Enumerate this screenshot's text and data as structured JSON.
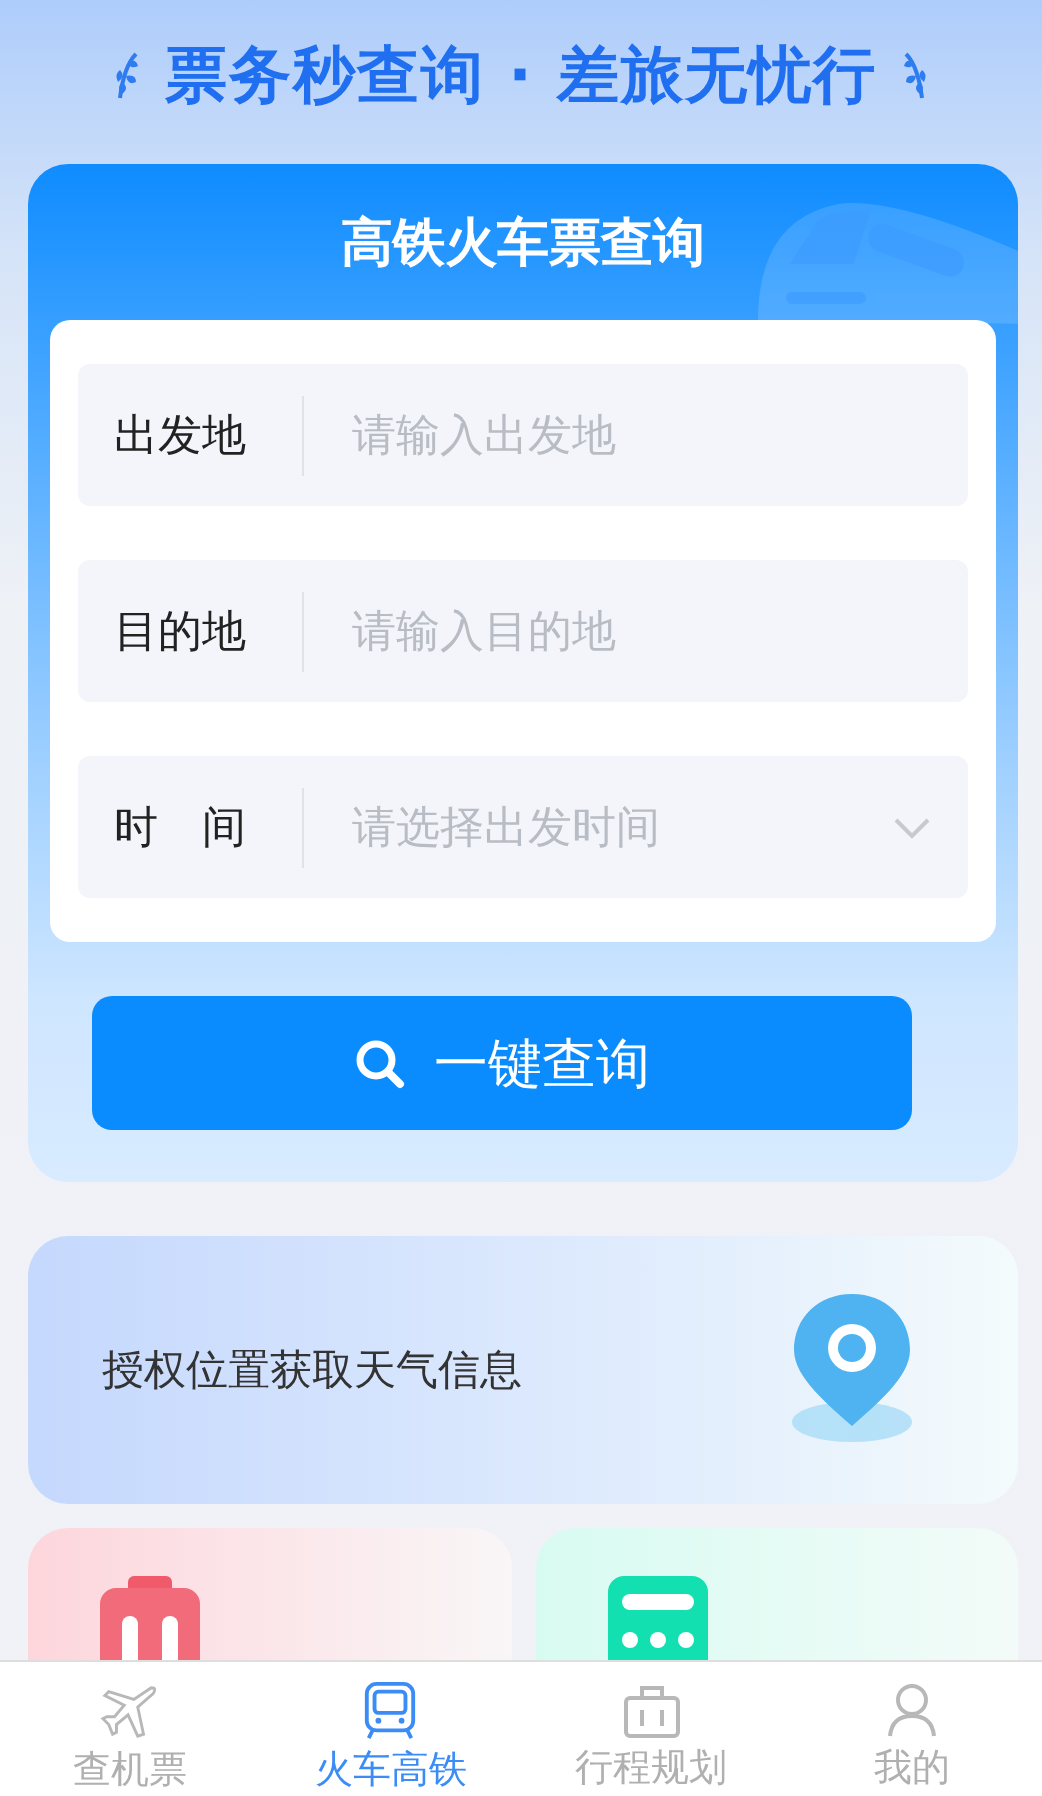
{
  "header": {
    "slogan": "票务秒查询 · 差旅无忧行"
  },
  "search_card": {
    "title": "高铁火车票查询",
    "fields": [
      {
        "kind": "input",
        "label": "出发地",
        "placeholder": "请输入出发地"
      },
      {
        "kind": "input",
        "label": "目的地",
        "placeholder": "请输入目的地"
      },
      {
        "kind": "select",
        "label": "时　间",
        "placeholder": "请选择出发时间"
      }
    ],
    "button": "一键查询"
  },
  "weather": {
    "text": "授权位置获取天气信息"
  },
  "tools": [
    {
      "kind": "guide"
    },
    {
      "kind": "calculator"
    }
  ],
  "tab_bar": [
    {
      "kind": "plane",
      "label": "查机票",
      "selected": false
    },
    {
      "kind": "train",
      "label": "火车高铁",
      "selected": true
    },
    {
      "kind": "bag",
      "label": "行程规划",
      "selected": false
    },
    {
      "kind": "person",
      "label": "我的",
      "selected": false
    }
  ]
}
